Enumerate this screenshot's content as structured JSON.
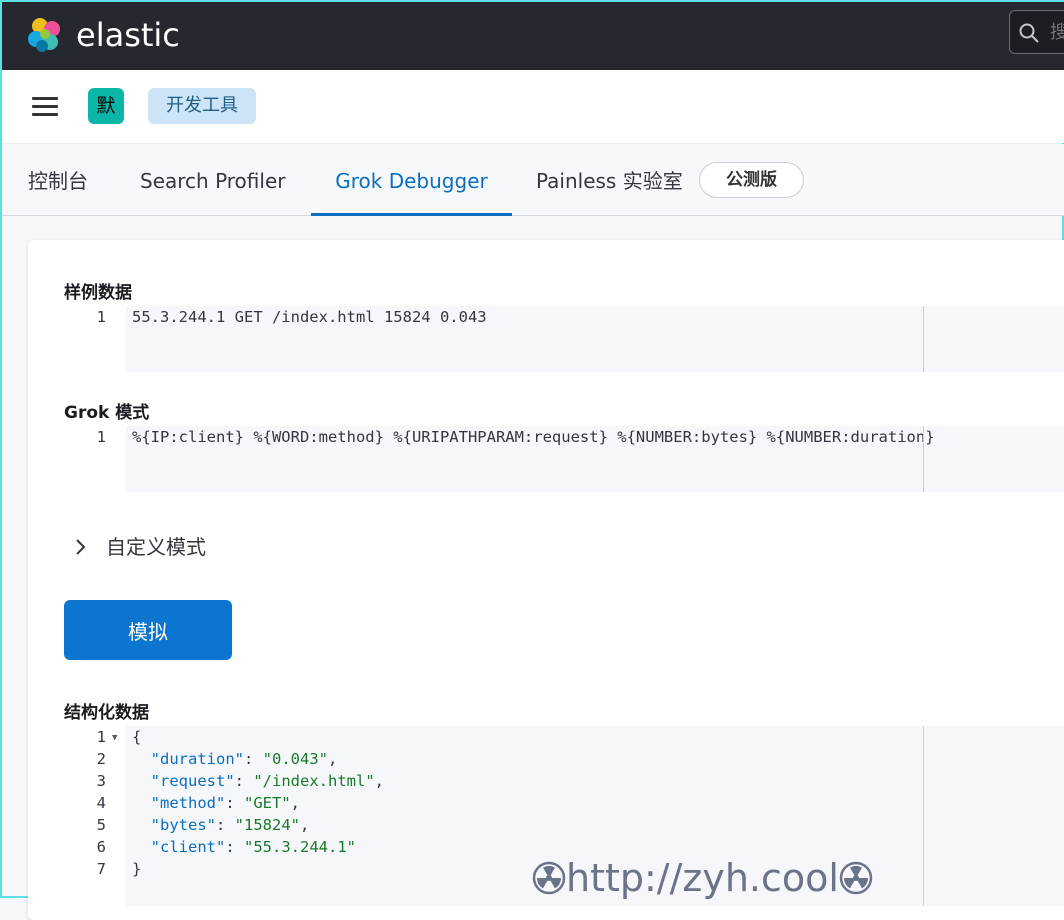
{
  "topbar": {
    "brand": "elastic",
    "search_placeholder": "搜"
  },
  "subheader": {
    "space_avatar": "默",
    "breadcrumb": "开发工具"
  },
  "tabs": [
    {
      "label": "控制台"
    },
    {
      "label": "Search Profiler"
    },
    {
      "label": "Grok Debugger",
      "active": true
    },
    {
      "label": "Painless 实验室"
    }
  ],
  "beta_badge": "公测版",
  "sample_data": {
    "label": "样例数据",
    "lines": [
      "55.3.244.1 GET /index.html 15824 0.043"
    ]
  },
  "grok_pattern": {
    "label": "Grok 模式",
    "lines": [
      "%{IP:client} %{WORD:method} %{URIPATHPARAM:request} %{NUMBER:bytes} %{NUMBER:duration}"
    ]
  },
  "custom_patterns": {
    "label": "自定义模式"
  },
  "simulate_button": "模拟",
  "structured_data": {
    "label": "结构化数据",
    "open_brace": "{",
    "close_brace": "}",
    "fields": [
      {
        "key": "\"duration\"",
        "value": "\"0.043\"",
        "sep": ","
      },
      {
        "key": "\"request\"",
        "value": "\"/index.html\"",
        "sep": ","
      },
      {
        "key": "\"method\"",
        "value": "\"GET\"",
        "sep": ","
      },
      {
        "key": "\"bytes\"",
        "value": "\"15824\"",
        "sep": ","
      },
      {
        "key": "\"client\"",
        "value": "\"55.3.244.1\"",
        "sep": ""
      }
    ],
    "line_numbers": [
      "1",
      "2",
      "3",
      "4",
      "5",
      "6",
      "7"
    ]
  },
  "watermark": "http://zyh.cool",
  "colors": {
    "topbar": "#25282f",
    "accent": "#0b6ebf",
    "button": "#0b75cf",
    "avatar": "#0bb5a8"
  }
}
